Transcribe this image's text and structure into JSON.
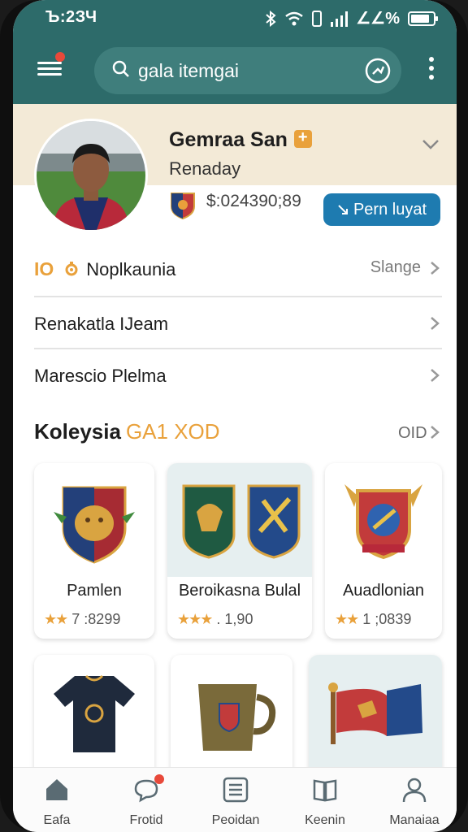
{
  "status_bar": {
    "time": "Ъ:2ЗЧ",
    "battery_text": "∠∠%"
  },
  "header": {
    "search_placeholder": "gala itemgai"
  },
  "profile": {
    "name": "Gemraa San",
    "subtitle": "Renaday",
    "balance": "$:024390;89",
    "cta_label": "Pern luyat"
  },
  "menu_rows": [
    {
      "rank": "IO",
      "label": "Noplkaunia",
      "right": "Slange"
    },
    {
      "label": "Renakatla IJeam"
    },
    {
      "label": "Marescio Plelma"
    }
  ],
  "collection": {
    "title": "Koleysia",
    "accent": "GA1 XOD",
    "more": "OID",
    "cards": [
      {
        "title": "Pamlen",
        "stars": "★★",
        "meta": "7 :8299"
      },
      {
        "title": "Beroikasna Bulal",
        "stars": "★★★",
        "meta": ". 1,90"
      },
      {
        "title": "Auadlonian",
        "stars": "★★",
        "meta": "1 ;0839"
      },
      {
        "title": ""
      },
      {
        "title": ""
      },
      {
        "title": ""
      }
    ]
  },
  "bottom_nav": [
    {
      "label": "Eafa"
    },
    {
      "label": "Frotid"
    },
    {
      "label": "Peoidan"
    },
    {
      "label": "Keenin"
    },
    {
      "label": "Manaiaa"
    }
  ],
  "colors": {
    "header": "#2d6b6a",
    "accent": "#e9a13b",
    "cta": "#1e7bb0",
    "alert": "#e8493a"
  }
}
